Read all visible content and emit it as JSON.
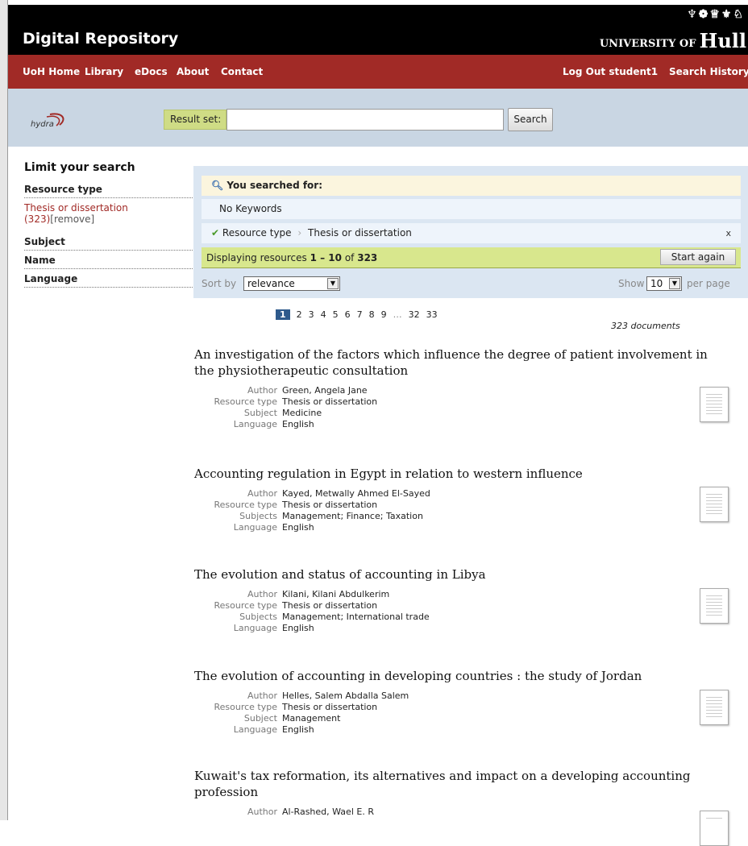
{
  "header": {
    "app_title": "Digital Repository",
    "university": {
      "prefix": "UNIVERSITY OF",
      "name": "Hull"
    },
    "crest_icons": "♆❁♕⚜♘"
  },
  "nav": {
    "left": [
      "UoH Home",
      "Library",
      "eDocs",
      "About",
      "Contact"
    ],
    "right": [
      "Log Out student1",
      "Search History"
    ]
  },
  "search": {
    "logo_text": "hydra",
    "result_set_label": "Result set:",
    "input_value": "",
    "button_label": "Search"
  },
  "sidebar": {
    "title": "Limit your search",
    "facets": [
      {
        "label": "Resource type",
        "value": "Thesis or dissertation",
        "count": "(323)",
        "remove": "[remove]"
      },
      {
        "label": "Subject"
      },
      {
        "label": "Name"
      },
      {
        "label": "Language"
      }
    ]
  },
  "constraints": {
    "searched_for": "You searched for:",
    "keywords": "No Keywords",
    "filter_field": "Resource type",
    "filter_value": "Thesis or dissertation",
    "filter_remove": "x",
    "displaying_prefix": "Displaying resources",
    "displaying_range": "1 – 10",
    "displaying_of": "of",
    "displaying_total": "323",
    "start_again": "Start again",
    "sort_label": "Sort by",
    "sort_value": "relevance",
    "show_label": "Show",
    "per_page_value": "10",
    "per_page_label": "per page"
  },
  "pagination": {
    "pages": [
      "1",
      "2",
      "3",
      "4",
      "5",
      "6",
      "7",
      "8",
      "9",
      "…",
      "32",
      "33"
    ],
    "current": "1",
    "doc_count": "323 documents"
  },
  "results": [
    {
      "title": "An investigation of the factors which influence the degree of patient involvement in the physiotherapeutic consultation",
      "fields": [
        {
          "label": "Author",
          "value": "Green, Angela Jane"
        },
        {
          "label": "Resource type",
          "value": "Thesis or dissertation"
        },
        {
          "label": "Subject",
          "value": "Medicine"
        },
        {
          "label": "Language",
          "value": "English"
        }
      ]
    },
    {
      "title": "Accounting regulation in Egypt in relation to western influence",
      "fields": [
        {
          "label": "Author",
          "value": "Kayed, Metwally Ahmed El-Sayed"
        },
        {
          "label": "Resource type",
          "value": "Thesis or dissertation"
        },
        {
          "label": "Subjects",
          "value": "Management; Finance; Taxation"
        },
        {
          "label": "Language",
          "value": "English"
        }
      ]
    },
    {
      "title": "The evolution and status of accounting in Libya",
      "fields": [
        {
          "label": "Author",
          "value": "Kilani, Kilani Abdulkerim"
        },
        {
          "label": "Resource type",
          "value": "Thesis or dissertation"
        },
        {
          "label": "Subjects",
          "value": "Management; International trade"
        },
        {
          "label": "Language",
          "value": "English"
        }
      ]
    },
    {
      "title": "The evolution of accounting in developing countries : the study of Jordan",
      "fields": [
        {
          "label": "Author",
          "value": "Helles, Salem Abdalla Salem"
        },
        {
          "label": "Resource type",
          "value": "Thesis or dissertation"
        },
        {
          "label": "Subject",
          "value": "Management"
        },
        {
          "label": "Language",
          "value": "English"
        }
      ]
    },
    {
      "title": "Kuwait's tax reformation, its alternatives and impact on a developing accounting profession",
      "fields": [
        {
          "label": "Author",
          "value": "Al-Rashed, Wael E. R"
        }
      ]
    }
  ],
  "colors": {
    "nav_red": "#a12a26",
    "search_band": "#c9d6e3",
    "result_panel": "#dbe6f2",
    "display_green": "#d8e78d",
    "pager_current": "#2e5a8c"
  }
}
